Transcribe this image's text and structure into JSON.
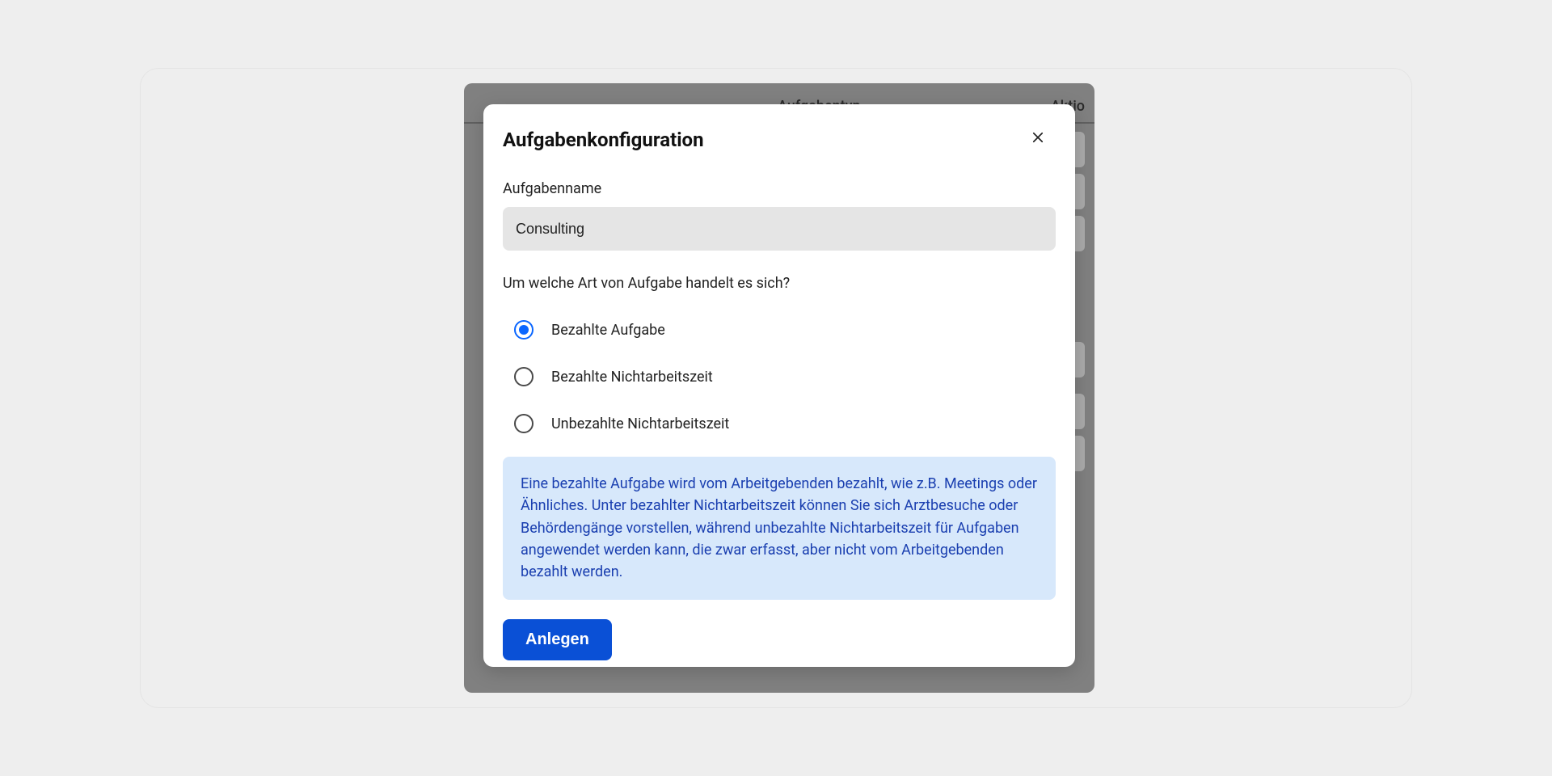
{
  "background": {
    "columns": {
      "type": "Aufgabentyp",
      "actions": "Aktio"
    }
  },
  "modal": {
    "title": "Aufgabenkonfiguration",
    "form": {
      "name_label": "Aufgabenname",
      "name_value": "Consulting",
      "type_question": "Um welche Art von Aufgabe handelt es sich?",
      "options": [
        {
          "label": "Bezahlte Aufgabe",
          "selected": true
        },
        {
          "label": "Bezahlte Nichtarbeitszeit",
          "selected": false
        },
        {
          "label": "Unbezahlte Nichtarbeitszeit",
          "selected": false
        }
      ],
      "info": "Eine bezahlte Aufgabe wird vom Arbeitgebenden bezahlt, wie z.B. Meetings oder Ähnliches. Unter bezahlter Nichtarbeitszeit können Sie sich Arztbesuche oder Behördengänge vorstellen, während unbezahlte Nichtarbeitszeit für Aufgaben angewendet werden kann, die zwar erfasst, aber nicht vom Arbeitgebenden bezahlt werden.",
      "submit_label": "Anlegen"
    }
  },
  "colors": {
    "accent": "#0a50d6",
    "radio": "#0a66ff",
    "info_bg": "#d7e8fb",
    "info_text": "#1a3fb0"
  }
}
